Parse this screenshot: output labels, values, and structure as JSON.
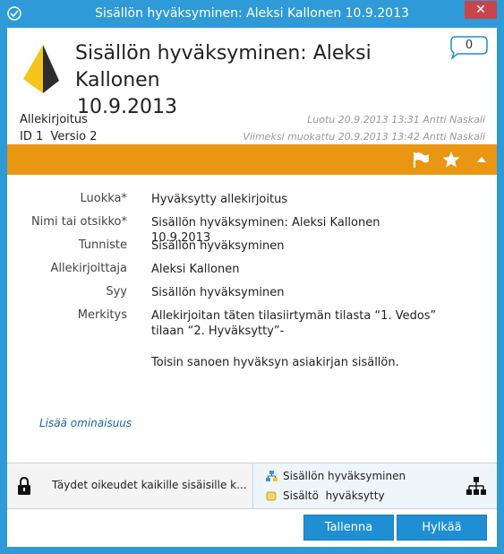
{
  "window": {
    "title": "Sisällön hyväksyminen: Aleksi Kallonen 10.9.2013",
    "close_glyph": "✕"
  },
  "header": {
    "title_line1": "Sisällön hyväksyminen: Aleksi Kallonen",
    "title_line2": "10.9.2013",
    "comment_count": "0",
    "icon": "pyramid-icon"
  },
  "meta": {
    "class_name": "Allekirjoitus",
    "id_version": "ID 1  Versio 2",
    "created": "Luotu 20.9.2013 13:31 Antti Naskali",
    "modified": "Viimeksi muokattu 20.9.2013 13:42 Antti Naskali"
  },
  "colors": {
    "accent": "#e99612",
    "button": "#1f8fd4",
    "window_frame": "#2f9ad8",
    "link": "#1b63b0"
  },
  "properties": [
    {
      "label": "Luokka*",
      "value": "Hyväksytty allekirjoitus"
    },
    {
      "label": "Nimi tai otsikko*",
      "value": "Sisällön hyväksyminen: Aleksi Kallonen 10.9.2013"
    },
    {
      "label": "Tunniste",
      "value": "Sisällön hyväksyminen"
    },
    {
      "label": "Allekirjoittaja",
      "value": "Aleksi Kallonen"
    },
    {
      "label": "Syy",
      "value": "Sisällön hyväksyminen"
    },
    {
      "label": "Merkitys",
      "value_p1": "Allekirjoitan täten tilasiirtymän tilasta “1. Vedos” tilaan “2. Hyväksytty”-",
      "value_p2": "Toisin sanoen hyväksyn asiakirjan sisällön."
    }
  ],
  "add_property_label": "Lisää ominaisuus",
  "permissions": {
    "text": "Täydet oikeudet kaikille sisäisille k..."
  },
  "workflow": {
    "name": "Sisällön hyväksyminen",
    "state": "Sisältö  hyväksytty"
  },
  "buttons": {
    "save": "Tallenna",
    "reject": "Hylkää"
  }
}
